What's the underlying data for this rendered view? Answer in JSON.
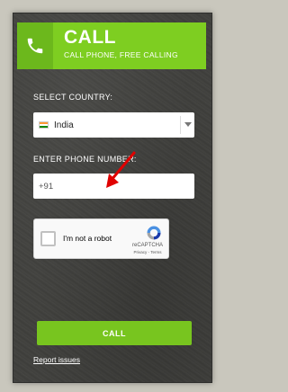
{
  "header": {
    "title": "CALL",
    "subtitle": "CALL PHONE, FREE CALLING",
    "icon": "phone-icon"
  },
  "form": {
    "country_label": "SELECT COUNTRY:",
    "country_value": "India",
    "country_flag": "india-flag-icon",
    "phone_label": "ENTER PHONE NUMBER:",
    "phone_value": "+91"
  },
  "recaptcha": {
    "label": "I'm not a robot",
    "brand": "reCAPTCHA",
    "links": "Privacy - Terms"
  },
  "actions": {
    "call_label": "CALL",
    "report_label": "Report issues"
  },
  "colors": {
    "accent": "#7ece21",
    "accent_dark": "#6cb81c",
    "annotation_arrow": "#e00000"
  }
}
